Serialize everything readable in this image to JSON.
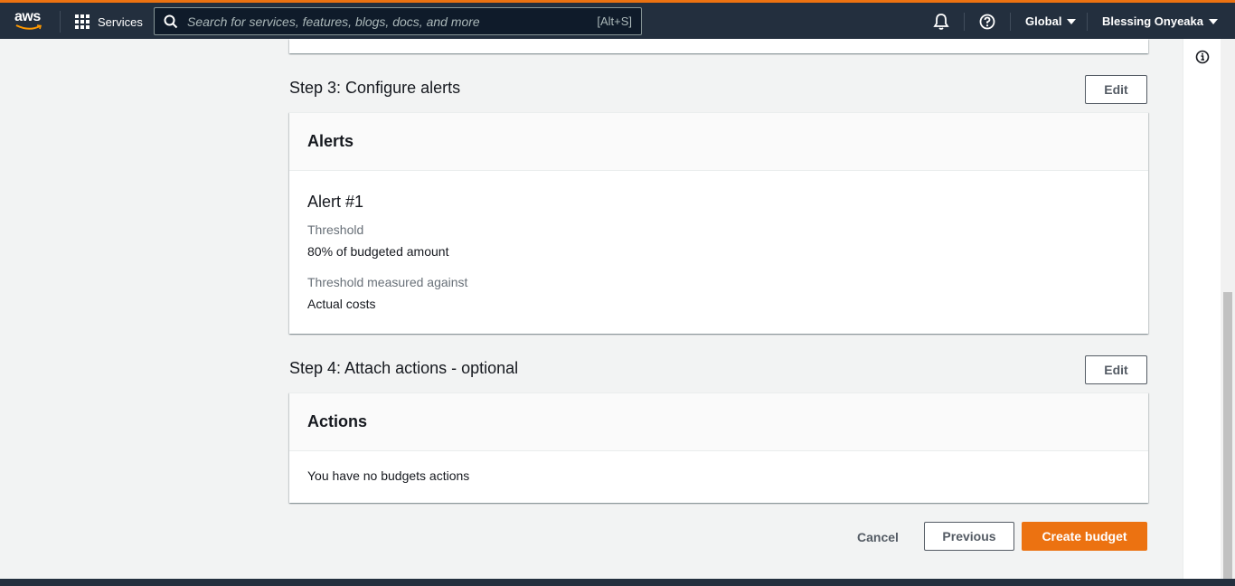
{
  "nav": {
    "logo_text": "aws",
    "services_label": "Services",
    "search_placeholder": "Search for services, features, blogs, docs, and more",
    "search_shortcut": "[Alt+S]",
    "region_label": "Global",
    "user_label": "Blessing Onyeaka",
    "accent_color": "#ec7211",
    "bg_color": "#232f3e"
  },
  "step3": {
    "title": "Step 3: Configure alerts",
    "edit_label": "Edit",
    "card_header": "Alerts",
    "alert": {
      "title": "Alert #1",
      "threshold_label": "Threshold",
      "threshold_value": "80% of budgeted amount",
      "measured_label": "Threshold measured against",
      "measured_value": "Actual costs"
    }
  },
  "step4": {
    "title": "Step 4: Attach actions - optional",
    "edit_label": "Edit",
    "card_header": "Actions",
    "empty_text": "You have no budgets actions"
  },
  "footer_actions": {
    "cancel_label": "Cancel",
    "previous_label": "Previous",
    "create_label": "Create budget",
    "create_color": "#ec7211"
  },
  "icons": {
    "grid": "grid-icon",
    "search": "search-icon",
    "bell": "bell-icon",
    "help": "help-icon",
    "info": "info-icon"
  }
}
